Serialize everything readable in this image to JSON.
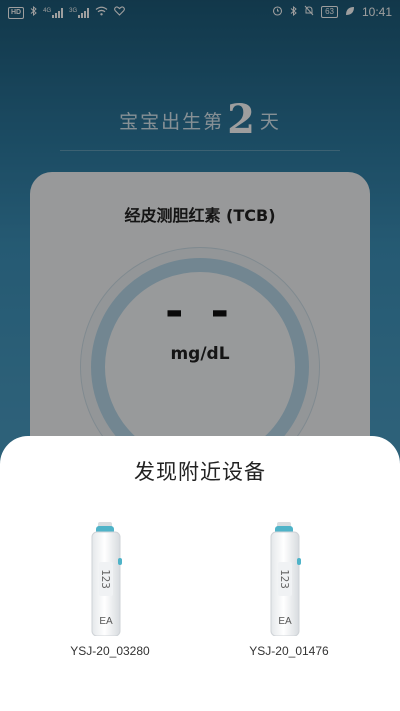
{
  "status_bar": {
    "network": "HD",
    "sig1_label": "4G",
    "sig2_label": "3G",
    "battery": "63",
    "time": "10:41"
  },
  "header": {
    "prefix": "宝宝出生第",
    "day": "2",
    "suffix": "天"
  },
  "card": {
    "title": "经皮测胆红素 (TCB)",
    "value": "- -",
    "unit": "mg/dL"
  },
  "sheet": {
    "title": "发现附近设备",
    "devices": [
      {
        "name": "YSJ-20_03280",
        "screen": "123",
        "logo": "EA"
      },
      {
        "name": "YSJ-20_01476",
        "screen": "123",
        "logo": "EA"
      }
    ]
  },
  "colors": {
    "accent": "#4fb3c8",
    "background_top": "#1d5a78",
    "background_bottom": "#4a9dc4"
  }
}
